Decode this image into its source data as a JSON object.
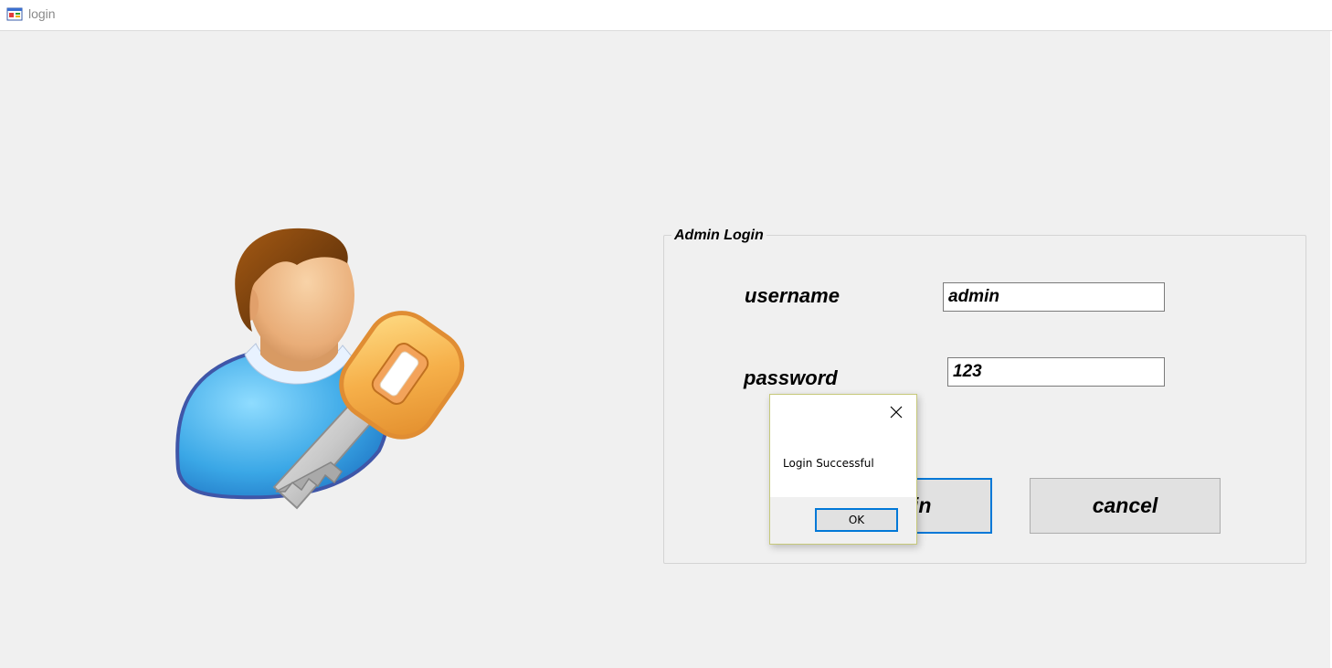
{
  "window": {
    "title": "login",
    "app_icon": "windows-forms-app-icon"
  },
  "illustration": {
    "icon": "user-with-key-icon"
  },
  "login_group": {
    "legend": "Admin Login",
    "username_label": "username",
    "username_value": "admin",
    "password_label": "password",
    "password_value": "123",
    "login_button_label": "in",
    "cancel_button_label": "cancel"
  },
  "message_box": {
    "message": "Login Successful",
    "ok_label": "OK",
    "close_icon": "close-icon"
  },
  "colors": {
    "focus_accent": "#0078d7",
    "background": "#f0f0f0",
    "button_face": "#e1e1e1"
  }
}
